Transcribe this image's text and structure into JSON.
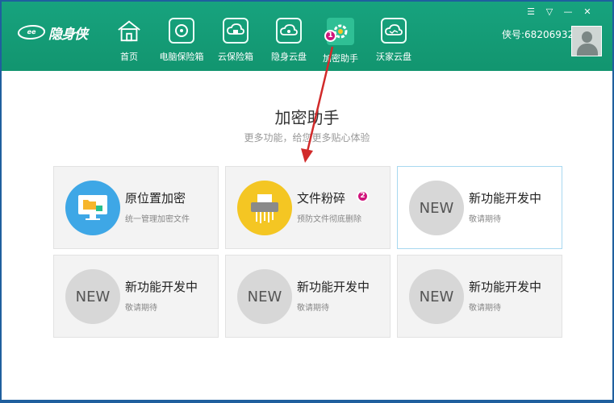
{
  "logo": {
    "mark": "ee",
    "text": "隐身侠"
  },
  "nav": [
    {
      "label": "首页",
      "icon": "home-icon"
    },
    {
      "label": "电脑保险箱",
      "icon": "safe-icon"
    },
    {
      "label": "云保险箱",
      "icon": "cloud-safe-icon"
    },
    {
      "label": "隐身云盘",
      "icon": "cloud-disk-icon"
    },
    {
      "label": "加密助手",
      "icon": "encrypt-assistant-icon"
    },
    {
      "label": "沃家云盘",
      "icon": "wo-cloud-icon"
    }
  ],
  "user": {
    "id_text": "侠号:68206932"
  },
  "window_controls": [
    "☰",
    "▽",
    "—",
    "✕"
  ],
  "page": {
    "title": "加密助手",
    "subtitle": "更多功能，给您更多贴心体验"
  },
  "cards": [
    {
      "title": "原位置加密",
      "sub": "统一管理加密文件",
      "icon": "monitor-folder-icon"
    },
    {
      "title": "文件粉碎",
      "sub": "预防文件彻底删除",
      "icon": "shredder-icon"
    },
    {
      "title": "新功能开发中",
      "sub": "敬请期待",
      "circle_text": "NEW"
    },
    {
      "title": "新功能开发中",
      "sub": "敬请期待",
      "circle_text": "NEW"
    },
    {
      "title": "新功能开发中",
      "sub": "敬请期待",
      "circle_text": "NEW"
    },
    {
      "title": "新功能开发中",
      "sub": "敬请期待",
      "circle_text": "NEW"
    }
  ],
  "annotations": {
    "badge1": "1",
    "badge2": "2"
  },
  "colors": {
    "header": "#12956f",
    "accent_blue": "#3ea7e6",
    "accent_yellow": "#f4c623",
    "badge": "#d0157c",
    "arrow": "#d12a2a"
  }
}
